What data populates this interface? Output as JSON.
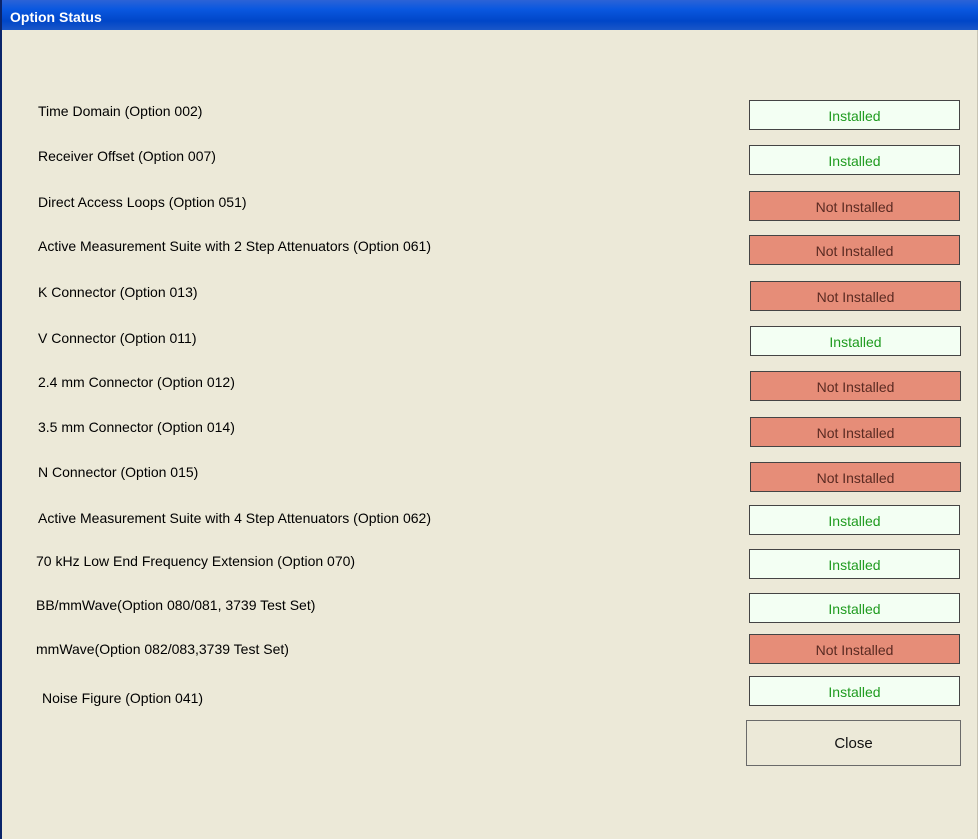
{
  "window": {
    "title": "Option Status"
  },
  "options": [
    {
      "label": "Time Domain (Option 002)",
      "status": "Installed"
    },
    {
      "label": "Receiver Offset (Option 007)",
      "status": "Installed"
    },
    {
      "label": "Direct Access Loops (Option 051)",
      "status": "Not Installed"
    },
    {
      "label": "Active Measurement Suite with 2 Step Attenuators (Option 061)",
      "status": "Not Installed"
    },
    {
      "label": "K Connector (Option 013)",
      "status": "Not Installed"
    },
    {
      "label": "V Connector (Option 011)",
      "status": "Installed"
    },
    {
      "label": "2.4 mm Connector (Option 012)",
      "status": "Not Installed"
    },
    {
      "label": "3.5 mm Connector (Option 014)",
      "status": "Not Installed"
    },
    {
      "label": "N Connector (Option 015)",
      "status": "Not Installed"
    },
    {
      "label": "Active Measurement Suite with 4 Step Attenuators (Option 062)",
      "status": "Installed"
    },
    {
      "label": "70 kHz Low End Frequency Extension (Option 070)",
      "status": "Installed"
    },
    {
      "label": "BB/mmWave(Option 080/081, 3739 Test Set)",
      "status": "Installed"
    },
    {
      "label": "mmWave(Option 082/083,3739 Test Set)",
      "status": "Not Installed"
    },
    {
      "label": "Noise Figure (Option 041)",
      "status": "Installed"
    }
  ],
  "buttons": {
    "close_label": "Close"
  },
  "colors": {
    "installed_bg": "#f3fff3",
    "installed_text": "#1f9b1f",
    "not_installed_bg": "#e68d78",
    "not_installed_text": "#5a2a22"
  }
}
